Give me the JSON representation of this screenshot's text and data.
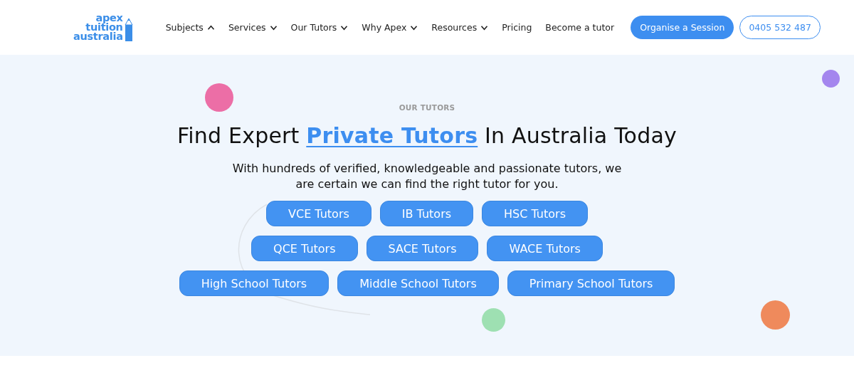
{
  "logo": {
    "lines": [
      "apex",
      "tuition",
      "australia"
    ]
  },
  "nav": [
    {
      "label": "Subjects",
      "kind": "dropdown",
      "expanded": true
    },
    {
      "label": "Services",
      "kind": "dropdown",
      "expanded": false
    },
    {
      "label": "Our Tutors",
      "kind": "dropdown",
      "expanded": false
    },
    {
      "label": "Why Apex",
      "kind": "dropdown",
      "expanded": false
    },
    {
      "label": "Resources",
      "kind": "dropdown",
      "expanded": false
    },
    {
      "label": "Pricing",
      "kind": "link"
    },
    {
      "label": "Become a tutor",
      "kind": "link"
    }
  ],
  "cta_button": "Organise a Session",
  "phone_button": "0405 532 487",
  "hero": {
    "eyebrow": "OUR TUTORS",
    "heading": "Find Expert **Private Tutors** In Australia Today",
    "subtitle": "With hundreds of verified, knowledgeable and passionate tutors, we are certain we can find the right tutor for you.",
    "button_rows": [
      [
        "VCE Tutors",
        "IB Tutors",
        "HSC Tutors"
      ],
      [
        "QCE Tutors",
        "SACE Tutors",
        "WACE Tutors"
      ],
      [
        "High School Tutors",
        "Middle School Tutors",
        "Primary School Tutors"
      ]
    ]
  }
}
